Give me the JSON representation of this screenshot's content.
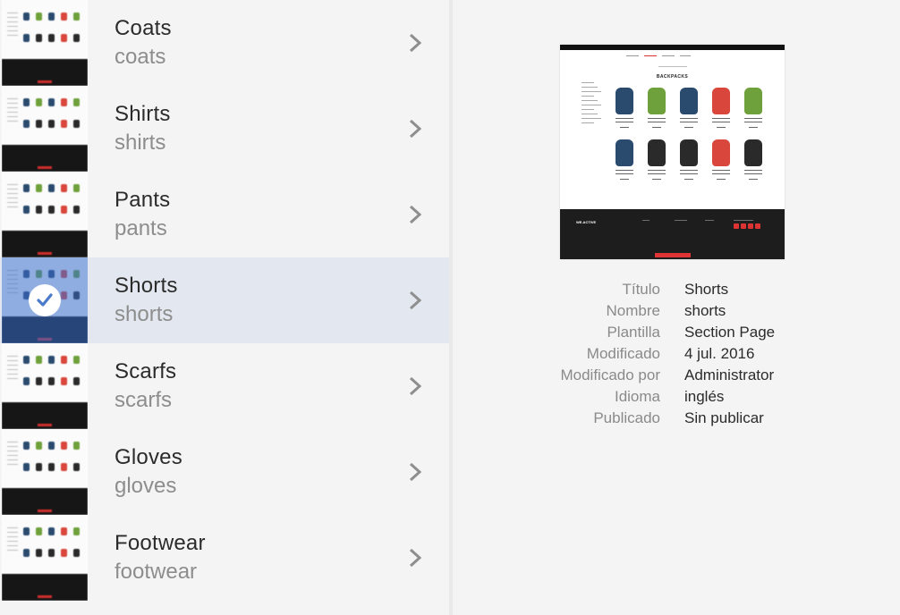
{
  "items": [
    {
      "title": "Coats",
      "name": "coats",
      "selected": false
    },
    {
      "title": "Shirts",
      "name": "shirts",
      "selected": false
    },
    {
      "title": "Pants",
      "name": "pants",
      "selected": false
    },
    {
      "title": "Shorts",
      "name": "shorts",
      "selected": true
    },
    {
      "title": "Scarfs",
      "name": "scarfs",
      "selected": false
    },
    {
      "title": "Gloves",
      "name": "gloves",
      "selected": false
    },
    {
      "title": "Footwear",
      "name": "footwear",
      "selected": false
    }
  ],
  "preview": {
    "heading": "BACKPACKS",
    "brand": "WE.ACTIVE"
  },
  "meta": [
    {
      "label": "Título",
      "value": "Shorts"
    },
    {
      "label": "Nombre",
      "value": "shorts"
    },
    {
      "label": "Plantilla",
      "value": "Section Page"
    },
    {
      "label": "Modificado",
      "value": "4 jul. 2016"
    },
    {
      "label": "Modificado por",
      "value": "Administrator"
    },
    {
      "label": "Idioma",
      "value": "inglés"
    },
    {
      "label": "Publicado",
      "value": "Sin publicar"
    }
  ],
  "colors": {
    "selection": "#386ecd",
    "pack_blue": "#2a4a6e",
    "pack_green": "#6ea13b",
    "pack_red": "#d8463c",
    "pack_black": "#2a2a2a"
  }
}
